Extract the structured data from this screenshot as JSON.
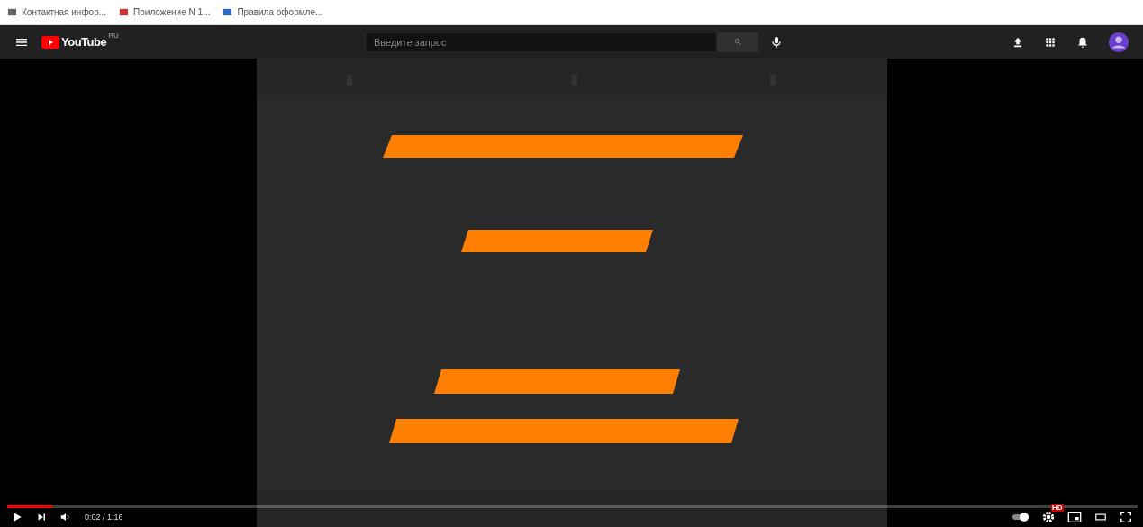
{
  "bookmarks": [
    {
      "label": "Контактная инфор..."
    },
    {
      "label": "Приложение N 1..."
    },
    {
      "label": "Правила оформле..."
    }
  ],
  "header": {
    "logo": "YouTube",
    "region": "RU",
    "search": {
      "placeholder": "Введите запрос"
    }
  },
  "player": {
    "progress": {
      "level": 0.04
    },
    "time": "0:02 / 1:16",
    "autoplay": {
      "on": true
    },
    "quality_badge": "HD"
  }
}
